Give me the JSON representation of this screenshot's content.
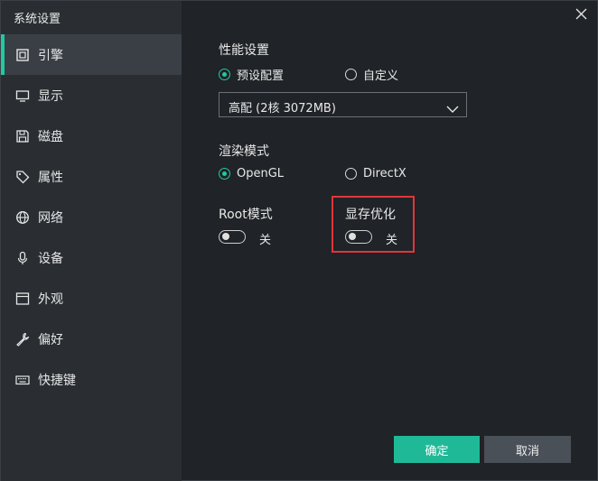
{
  "window": {
    "title": "系统设置",
    "close_icon": "close-icon"
  },
  "sidebar": {
    "items": [
      {
        "label": "引擎",
        "icon": "chip-icon",
        "active": true
      },
      {
        "label": "显示",
        "icon": "monitor-icon",
        "active": false
      },
      {
        "label": "磁盘",
        "icon": "disk-icon",
        "active": false
      },
      {
        "label": "属性",
        "icon": "tag-icon",
        "active": false
      },
      {
        "label": "网络",
        "icon": "globe-icon",
        "active": false
      },
      {
        "label": "设备",
        "icon": "microphone-icon",
        "active": false
      },
      {
        "label": "外观",
        "icon": "window-icon",
        "active": false
      },
      {
        "label": "偏好",
        "icon": "wrench-icon",
        "active": false
      },
      {
        "label": "快捷键",
        "icon": "keyboard-icon",
        "active": false
      }
    ]
  },
  "performance": {
    "title": "性能设置",
    "options": [
      {
        "label": "预设配置",
        "checked": true
      },
      {
        "label": "自定义",
        "checked": false
      }
    ],
    "select_value": "高配 (2核 3072MB)"
  },
  "render": {
    "title": "渲染模式",
    "options": [
      {
        "label": "OpenGL",
        "checked": true
      },
      {
        "label": "DirectX",
        "checked": false
      }
    ]
  },
  "root_mode": {
    "title": "Root模式",
    "state_label": "关",
    "on": false
  },
  "memory_opt": {
    "title": "显存优化",
    "state_label": "关",
    "on": false
  },
  "buttons": {
    "ok": "确定",
    "cancel": "取消"
  },
  "colors": {
    "accent": "#21c9a3",
    "highlight": "#e0363b",
    "ok_button": "#1fb998"
  }
}
